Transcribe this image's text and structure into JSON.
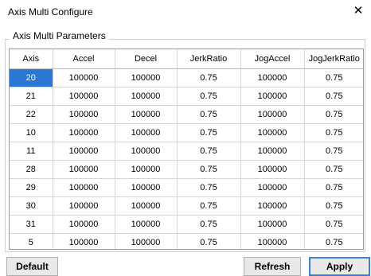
{
  "window": {
    "title": "Axis Multi Configure",
    "close_glyph": "✕"
  },
  "group": {
    "legend": "Axis Multi Parameters"
  },
  "table": {
    "columns": [
      "Axis",
      "Accel",
      "Decel",
      "JerkRatio",
      "JogAccel",
      "JogJerkRatio"
    ],
    "selected_row": 0,
    "rows": [
      [
        "20",
        "100000",
        "100000",
        "0.75",
        "100000",
        "0.75"
      ],
      [
        "21",
        "100000",
        "100000",
        "0.75",
        "100000",
        "0.75"
      ],
      [
        "22",
        "100000",
        "100000",
        "0.75",
        "100000",
        "0.75"
      ],
      [
        "10",
        "100000",
        "100000",
        "0.75",
        "100000",
        "0.75"
      ],
      [
        "11",
        "100000",
        "100000",
        "0.75",
        "100000",
        "0.75"
      ],
      [
        "28",
        "100000",
        "100000",
        "0.75",
        "100000",
        "0.75"
      ],
      [
        "29",
        "100000",
        "100000",
        "0.75",
        "100000",
        "0.75"
      ],
      [
        "30",
        "100000",
        "100000",
        "0.75",
        "100000",
        "0.75"
      ],
      [
        "31",
        "100000",
        "100000",
        "0.75",
        "100000",
        "0.75"
      ],
      [
        "5",
        "100000",
        "100000",
        "0.75",
        "100000",
        "0.75"
      ]
    ]
  },
  "buttons": {
    "default": "Default",
    "refresh": "Refresh",
    "apply": "Apply"
  },
  "colors": {
    "selection": "#2b77d6",
    "apply_border": "#3b7fd6"
  }
}
